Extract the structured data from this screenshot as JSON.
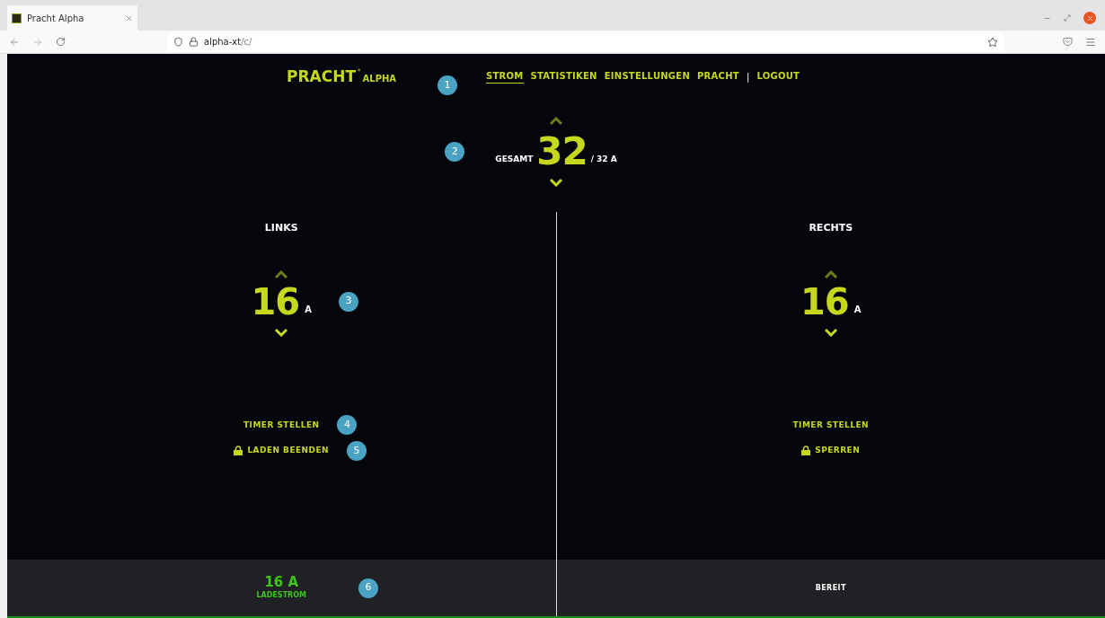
{
  "browser": {
    "tab_title": "Pracht Alpha",
    "url_host": "alpha-xt",
    "url_path": "/c/"
  },
  "header": {
    "logo": "PRACHT",
    "logo_mark": "°",
    "logo_sub": "ALPHA",
    "callout": "1",
    "nav": [
      {
        "kind": "link",
        "label": "STROM",
        "selected": true
      },
      {
        "kind": "link",
        "label": "STATISTIKEN",
        "selected": false
      },
      {
        "kind": "link",
        "label": "EINSTELLUNGEN",
        "selected": false
      },
      {
        "kind": "link",
        "label": "PRACHT",
        "selected": false
      },
      {
        "kind": "separator",
        "label": "|"
      },
      {
        "kind": "link",
        "label": "LOGOUT",
        "selected": false
      }
    ]
  },
  "total": {
    "label": "GESAMT",
    "value": "32",
    "max": "/ 32 A",
    "callout": "2"
  },
  "sides": [
    {
      "title": "LINKS",
      "value": "16",
      "unit": "A",
      "callout": "3",
      "actions": [
        {
          "kind": "timer",
          "label": "TIMER STELLEN",
          "callout": "4"
        },
        {
          "kind": "lock",
          "label": "LADEN BEENDEN",
          "callout": "5"
        }
      ],
      "status": {
        "kind": "current",
        "value": "16 A",
        "label": "LADESTROM",
        "callout": "6"
      }
    },
    {
      "title": "RECHTS",
      "value": "16",
      "unit": "A",
      "actions": [
        {
          "kind": "timer",
          "label": "TIMER STELLEN"
        },
        {
          "kind": "lock",
          "label": "SPERREN"
        }
      ],
      "status": {
        "kind": "text",
        "value": "BEREIT"
      }
    }
  ]
}
